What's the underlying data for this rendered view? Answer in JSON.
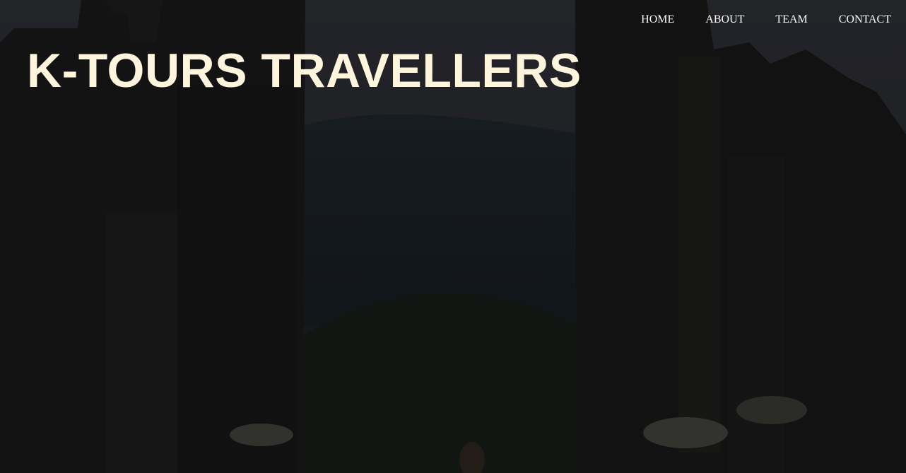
{
  "nav": {
    "items": [
      {
        "label": "HOME"
      },
      {
        "label": "ABOUT"
      },
      {
        "label": "TEAM"
      },
      {
        "label": "CONTACT"
      }
    ]
  },
  "hero": {
    "title": "K-TOURS TRAVELLERS",
    "background_image": "temple-gate-photo",
    "title_color": "#fff5dc",
    "nav_color": "#ffffff"
  }
}
